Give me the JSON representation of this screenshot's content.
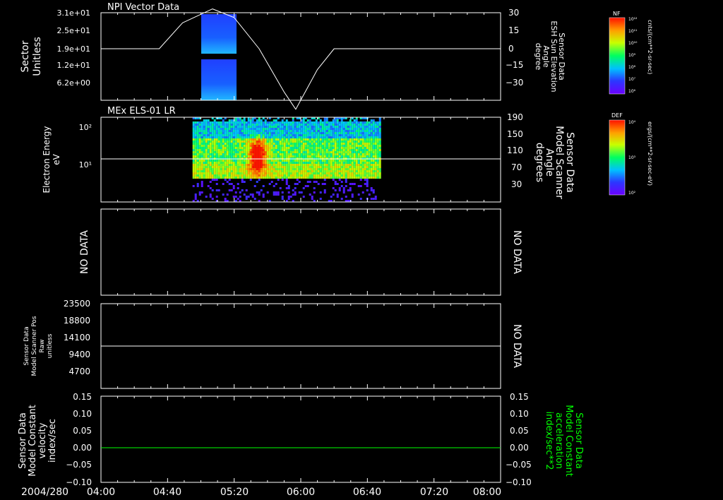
{
  "colors": {
    "background": "#000000",
    "foreground": "#ffffff",
    "accent_green": "#00ff00"
  },
  "time_axis": {
    "date_label": "2004/280",
    "tick_labels": [
      "04:00",
      "04:40",
      "05:20",
      "06:00",
      "06:40",
      "07:20",
      "08:00"
    ]
  },
  "panels": {
    "p1": {
      "title": "NPI Vector Data",
      "left_label": [
        "Sector",
        "Unitless"
      ],
      "left_ticks": [
        "3.1e+01",
        "2.5e+01",
        "1.9e+01",
        "1.2e+01",
        "6.2e+00"
      ],
      "right_ticks": [
        "30",
        "15",
        "0",
        "−15",
        "−30"
      ],
      "right_label": [
        "Sensor Data",
        "ESH Sun Elevation",
        "Angle",
        "degree"
      ],
      "colorbar": {
        "label": "NF",
        "units": "cnts/(cm**2-sr-sec)",
        "ticks": [
          "10¹²",
          "10¹¹",
          "10¹⁰",
          "10⁹",
          "10⁸",
          "10⁷",
          "10⁶"
        ]
      }
    },
    "p2": {
      "title": "MEx ELS-01 LR",
      "left_label": [
        "Electron Energy",
        "eV"
      ],
      "left_ticks": [
        "10²",
        "10¹"
      ],
      "right_ticks": [
        "190",
        "150",
        "110",
        "70",
        "30"
      ],
      "right_label": [
        "Sensor Data",
        "Model Scanner",
        "Angle",
        "degrees"
      ],
      "colorbar": {
        "label": "DEF",
        "units": "ergs/(cm**2-sr-sec-eV)",
        "ticks": [
          "10⁴",
          "10³",
          "10²"
        ]
      }
    },
    "p3": {
      "left_label": "NO DATA",
      "right_label": "NO DATA"
    },
    "p4": {
      "left_label": [
        "Sensor Data",
        "Model Scanner Pos",
        "Raw",
        "unitless"
      ],
      "left_ticks": [
        "23500",
        "18800",
        "14100",
        "9400",
        "4700"
      ],
      "right_label": "NO DATA"
    },
    "p5": {
      "left_label": [
        "Sensor Data",
        "Model Constant",
        "velocity",
        "index/sec"
      ],
      "left_ticks": [
        "0.15",
        "0.10",
        "0.05",
        "0.00",
        "−0.05",
        "−0.10"
      ],
      "right_ticks": [
        "0.15",
        "0.10",
        "0.05",
        "0.00",
        "−0.05",
        "−0.10"
      ],
      "right_label": [
        "Sensor Data",
        "Model Constant",
        "acceleration",
        "index/sec**2"
      ]
    }
  },
  "chart_data": [
    {
      "type": "line",
      "panel": "p1",
      "x_range": [
        "04:00",
        "08:00"
      ],
      "ylim": [
        -45,
        30
      ],
      "series": [
        {
          "x": [
            "04:00",
            "04:35",
            "04:49",
            "05:07",
            "05:20",
            "05:35",
            "05:50",
            "05:57",
            "06:10",
            "06:20",
            "08:00"
          ],
          "y": [
            0,
            0,
            15,
            23,
            18,
            0,
            -25,
            -35,
            -12,
            0,
            0
          ]
        }
      ]
    },
    {
      "type": "heatmap",
      "panel": "p1",
      "x_range": [
        "04:49",
        "05:07"
      ],
      "description_values": "sector count spectrogram, Sector 0-31"
    },
    {
      "type": "heatmap",
      "panel": "p2",
      "x_range": [
        "04:55",
        "06:48"
      ],
      "ylim_log10": [
        0,
        2.2
      ]
    },
    {
      "type": "line",
      "panel": "p2",
      "ylim": [
        0,
        190
      ],
      "series": [
        {
          "x": [
            "04:00",
            "08:00"
          ],
          "y": [
            90,
            90
          ]
        }
      ]
    },
    {
      "type": "line",
      "panel": "p4",
      "ylim": [
        0,
        23500
      ],
      "series": [
        {
          "x": [
            "04:00",
            "08:00"
          ],
          "y": [
            11750,
            11750
          ]
        }
      ]
    },
    {
      "type": "line",
      "panel": "p5",
      "ylim": [
        -0.1,
        0.15
      ],
      "series": [
        {
          "x": [
            "04:00",
            "08:00"
          ],
          "y": [
            0,
            0
          ]
        }
      ]
    }
  ]
}
